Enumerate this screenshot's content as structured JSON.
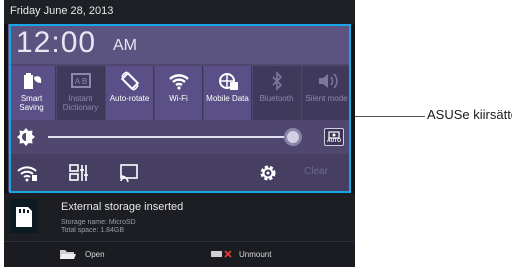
{
  "statusbar": {
    "date": "Friday June 28, 2013"
  },
  "clock": {
    "time": "12:00",
    "ampm": "AM"
  },
  "tiles": [
    {
      "label": "Smart Saving",
      "icon": "battery-leaf-icon",
      "state": "on"
    },
    {
      "label": "Instant Dictionary",
      "icon": "dictionary-icon",
      "state": "off"
    },
    {
      "label": "Auto-rotate",
      "icon": "rotate-icon",
      "state": "on"
    },
    {
      "label": "Wi-Fi",
      "icon": "wifi-icon",
      "state": "on"
    },
    {
      "label": "Mobile Data",
      "icon": "mobile-data-icon",
      "state": "on"
    },
    {
      "label": "Bluetooth",
      "icon": "bluetooth-icon",
      "state": "off"
    },
    {
      "label": "Silent mode",
      "icon": "speaker-icon",
      "state": "off"
    }
  ],
  "brightness": {
    "level": 0.95,
    "auto_label": "AUTO"
  },
  "bottom": {
    "clear_label": "Clear"
  },
  "notification": {
    "title": "External storage inserted",
    "line1": "Storage name: MicroSD",
    "line2": "Total space: 1.84GB"
  },
  "actions": {
    "open_label": "Open",
    "unmount_label": "Unmount"
  },
  "callout": {
    "label": "ASUSe kiirsätted"
  },
  "colors": {
    "frame": "#19a6e6",
    "panel": "#4f476e",
    "accent_red": "#e53935"
  }
}
